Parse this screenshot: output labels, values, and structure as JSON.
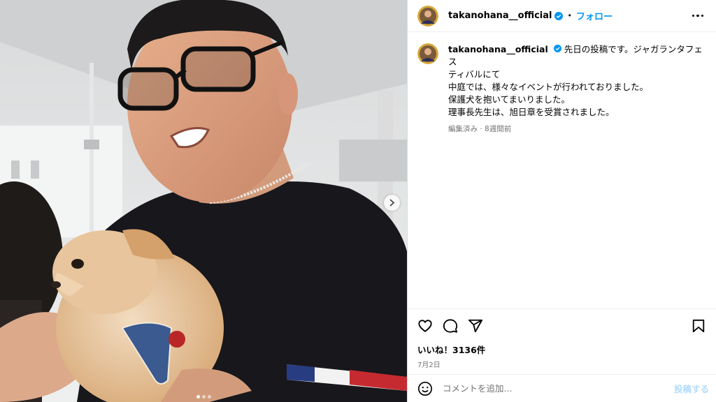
{
  "post": {
    "media": {
      "carousel_count": 3,
      "active_index": 0,
      "next_icon": "chevron-right-icon"
    },
    "header": {
      "username": "takanohana__official",
      "verified": true,
      "separator": "•",
      "follow_label": "フォロー",
      "more_icon": "more-options-icon"
    },
    "caption": {
      "username": "takanohana__official",
      "lines": [
        "先日の投稿です。ジャガランタフェス",
        "ティバルにて",
        "中庭では、様々なイベントが行われておりました。",
        "保護犬を抱いてまいりました。",
        "理事長先生は、旭日章を受賞されました。"
      ],
      "meta": "編集済み · 8週間前"
    },
    "actions": {
      "like_icon": "heart-icon",
      "comment_icon": "comment-icon",
      "share_icon": "share-icon",
      "save_icon": "bookmark-icon"
    },
    "likes_text": "いいね！3136件",
    "date_text": "7月2日",
    "comment_bar": {
      "emoji_icon": "emoji-icon",
      "placeholder": "コメントを追加...",
      "post_label": "投稿する"
    },
    "colors": {
      "accent": "#0095f6",
      "post_disabled": "#b3dbfb",
      "muted": "#737373",
      "border": "#dbdbdb"
    }
  }
}
